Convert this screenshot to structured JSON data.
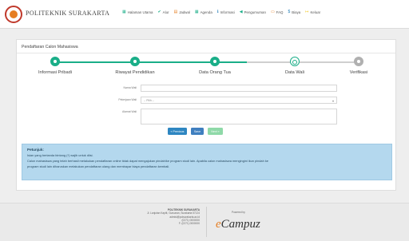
{
  "header": {
    "brand": "POLITEKNIK SURAKARTA",
    "nav": [
      {
        "icon": "home-icon",
        "glyph": "▦",
        "label": "Halaman Utama",
        "color": "#1aae88"
      },
      {
        "icon": "check-icon",
        "glyph": "✔",
        "label": "Alur",
        "color": "#1aae88"
      },
      {
        "icon": "calendar-icon",
        "glyph": "▤",
        "label": "Jadwal",
        "color": "#e67e22"
      },
      {
        "icon": "agenda-icon",
        "glyph": "▦",
        "label": "Agenda",
        "color": "#1aae88"
      },
      {
        "icon": "info-icon",
        "glyph": "ℹ",
        "label": "Informasi",
        "color": "#2980b9"
      },
      {
        "icon": "announcement-icon",
        "glyph": "◀",
        "label": "Pengumuman",
        "color": "#1aae88"
      },
      {
        "icon": "faq-icon",
        "glyph": "▭",
        "label": "FAQ",
        "color": "#e67e22"
      },
      {
        "icon": "currency-icon",
        "glyph": "$",
        "label": "Biaya",
        "color": "#2980b9"
      },
      {
        "icon": "logout-icon",
        "glyph": "↦",
        "label": "Keluar",
        "color": "#f1c40f"
      }
    ]
  },
  "panel": {
    "title": "Pendaftaran Calon Mahasiswa"
  },
  "wizard": {
    "steps": [
      {
        "label": "Informasi Pribadi",
        "state": "done"
      },
      {
        "label": "Riwayat Pendidikan",
        "state": "done"
      },
      {
        "label": "Data Orang Tua",
        "state": "done"
      },
      {
        "label": "Data Wali",
        "state": "current"
      },
      {
        "label": "Verifikasi",
        "state": "todo"
      }
    ],
    "done_color": "#1aae88",
    "todo_color": "#b0b0b0"
  },
  "form": {
    "nama_wali_label": "Nama Wali",
    "nama_wali_value": "",
    "pekerjaan_wali_label": "Pekerjaan Wali",
    "pekerjaan_wali_value": "-- Pilih --",
    "alamat_wali_label": "Alamat Wali",
    "alamat_wali_value": ""
  },
  "buttons": {
    "previous": "« Previous",
    "save": "Save",
    "next": "Next »"
  },
  "alert": {
    "title": "Petunjuk:",
    "line1": "Isian yang bertanda bintang (*) wajib untuk diisi.",
    "line2": "Calon mahasiswa yang telah berhasil melakukan pendaftaran online tidak dapat mengajukan pindah/ke program studi lain. Apabila calon mahasiswa mengingini ikun pindah ke",
    "line3": "program studi lain diharuskan melakukan pendaftaran ulang dan membayar biaya pendaftaran kembali."
  },
  "footer": {
    "name": "POLITEKNIK SURAKARTA",
    "address": "Jl. Lanjutan Kaptit, Guruaran, Surakarta 57124",
    "email": "admisi@polsurakarta.ac.id",
    "phone": "(0271) 0000000",
    "fax": "F: (0271) 0000000",
    "powered_by": "Powered by",
    "product_prefix": "e",
    "product_name": "Campuz"
  }
}
